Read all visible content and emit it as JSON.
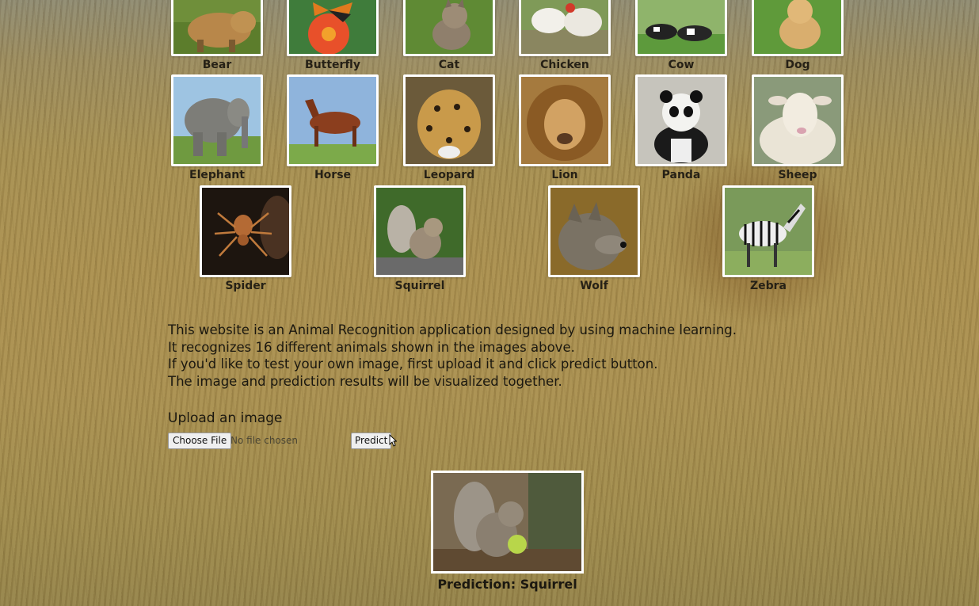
{
  "gallery": {
    "animals": [
      {
        "label": "Bear"
      },
      {
        "label": "Butterfly"
      },
      {
        "label": "Cat"
      },
      {
        "label": "Chicken"
      },
      {
        "label": "Cow"
      },
      {
        "label": "Dog"
      },
      {
        "label": "Elephant"
      },
      {
        "label": "Horse"
      },
      {
        "label": "Leopard"
      },
      {
        "label": "Lion"
      },
      {
        "label": "Panda"
      },
      {
        "label": "Sheep"
      },
      {
        "label": "Spider"
      },
      {
        "label": "Squirrel"
      },
      {
        "label": "Wolf"
      },
      {
        "label": "Zebra"
      }
    ]
  },
  "description": {
    "lines": [
      "This website is an Animal Recognition application designed by using machine learning.",
      "It recognizes 16 different animals shown in the images above.",
      "If you'd like to test your own image, first upload it and click predict button.",
      "The image and prediction results will be visualized together."
    ]
  },
  "upload": {
    "title": "Upload an image",
    "choose_file_label": "Choose File",
    "file_status": "No file chosen",
    "predict_label": "Predict"
  },
  "result": {
    "prediction_text": "Prediction: Squirrel"
  }
}
